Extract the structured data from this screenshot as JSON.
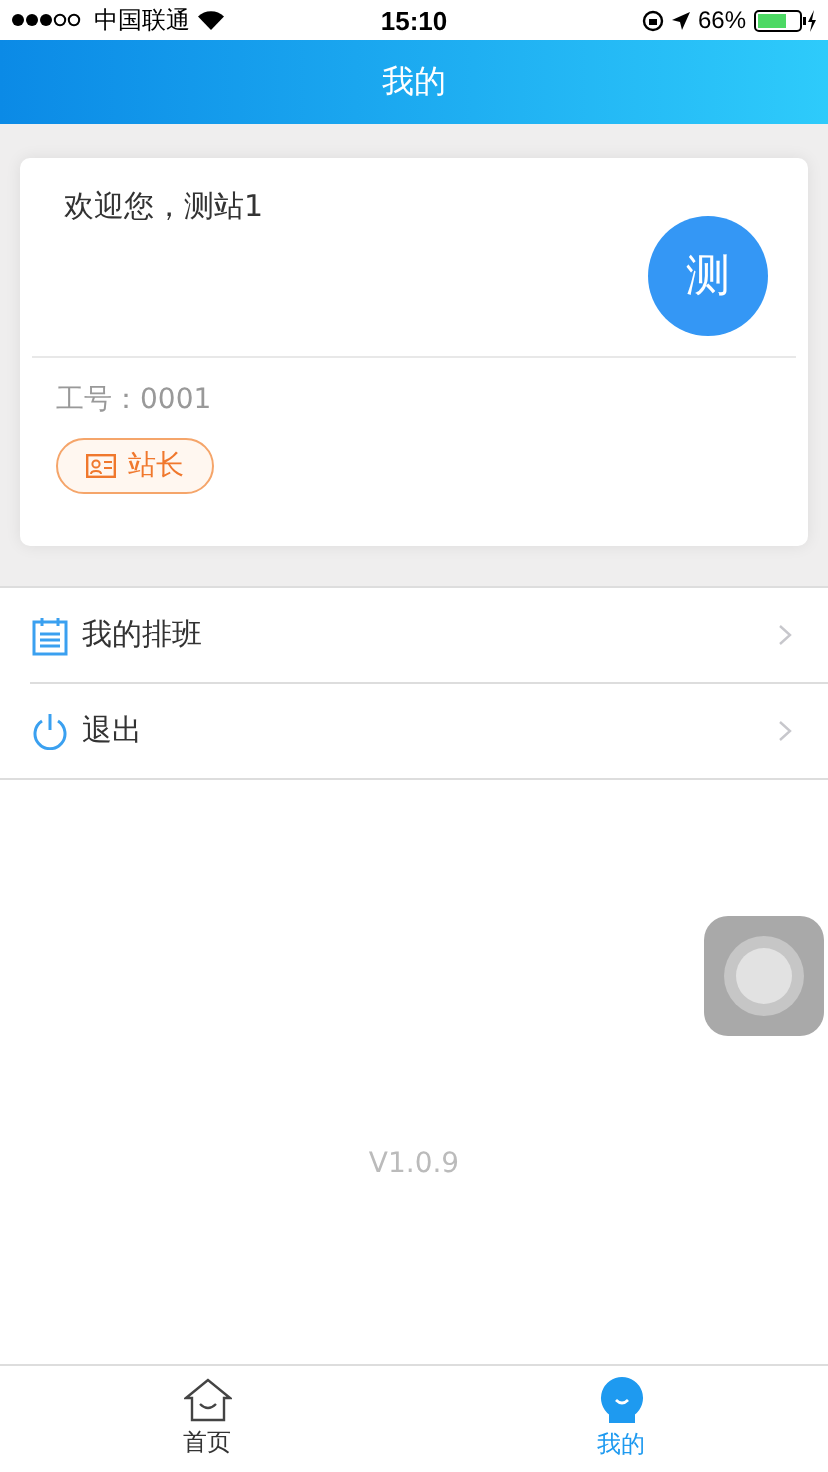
{
  "status_bar": {
    "carrier": "中国联通",
    "time": "15:10",
    "battery": "66%"
  },
  "header": {
    "title": "我的"
  },
  "profile": {
    "greeting": "欢迎您，测站1",
    "avatar": "测",
    "employee_id": "工号：0001",
    "role": "站长"
  },
  "menu": [
    {
      "kind": "schedule",
      "label": "我的排班"
    },
    {
      "kind": "logout",
      "label": "退出"
    }
  ],
  "version": "V1.0.9",
  "tabs": [
    {
      "kind": "home",
      "label": "首页",
      "selected": false
    },
    {
      "kind": "me",
      "label": "我的",
      "selected": true
    }
  ]
}
